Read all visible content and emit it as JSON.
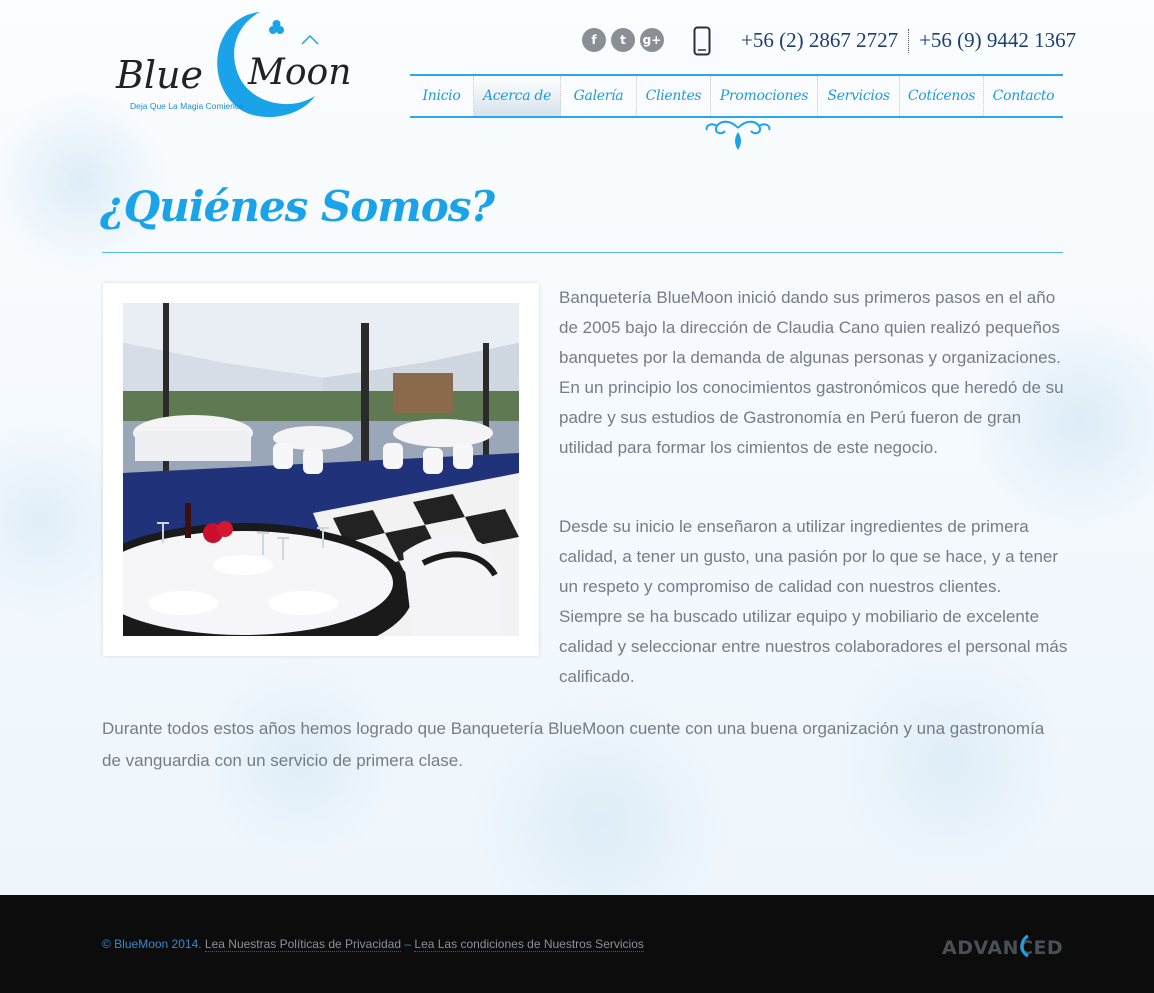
{
  "header": {
    "logo": {
      "word1": "Blue",
      "word2": "Moon",
      "tagline": "Deja Que La Magia Comience"
    },
    "social": [
      {
        "label": "f",
        "icon": "facebook-icon"
      },
      {
        "label": "t",
        "icon": "twitter-icon"
      },
      {
        "label": "g+",
        "icon": "google-plus-icon"
      }
    ],
    "phones": [
      "+56 (2) 2867 2727",
      "+56 (9) 9442 1367"
    ]
  },
  "nav": {
    "items": [
      "Inicio",
      "Acerca de",
      "Galería",
      "Clientes",
      "Promociones",
      "Servicios",
      "Cotícenos",
      "Contacto"
    ],
    "active": "Acerca de"
  },
  "main": {
    "title": "¿Quiénes Somos?",
    "paragraph1": "Banquetería BlueMoon inició dando sus primeros pasos en el año de 2005 bajo la dirección de Claudia Cano quien realizó pequeños banquetes por la demanda de algunas personas y organizaciones. En un principio los conocimientos gastronómicos que heredó de su padre y sus estudios de Gastronomía en Perú fueron de gran utilidad para formar los cimientos de este negocio.",
    "paragraph2": "Desde su inicio le enseñaron a utilizar ingredientes de primera calidad, a tener un gusto, una pasión por lo que se hace, y a tener un respeto y compromiso de calidad con nuestros clientes. Siempre se ha buscado utilizar equipo y mobiliario de excelente calidad y seleccionar entre nuestros colaboradores el personal más calificado.",
    "paragraph3": "Durante todos estos años hemos logrado que Banquetería BlueMoon cuente con una buena organización y una gastronomía de vanguardia con un servicio de primera clase."
  },
  "footer": {
    "copyright": "© BlueMoon 2014.",
    "privacy_link": "Lea Nuestras Políticas de Privacidad",
    "separator": "–",
    "terms_link": "Lea Las condiciones de Nuestros Servicios",
    "brand": "ADVANCED"
  },
  "colors": {
    "accent": "#1aa3e8",
    "nav_border": "#29a9e6",
    "phone_text": "#1c3f6e",
    "body_text": "#757c86",
    "footer_bg": "#0c0c0c"
  }
}
